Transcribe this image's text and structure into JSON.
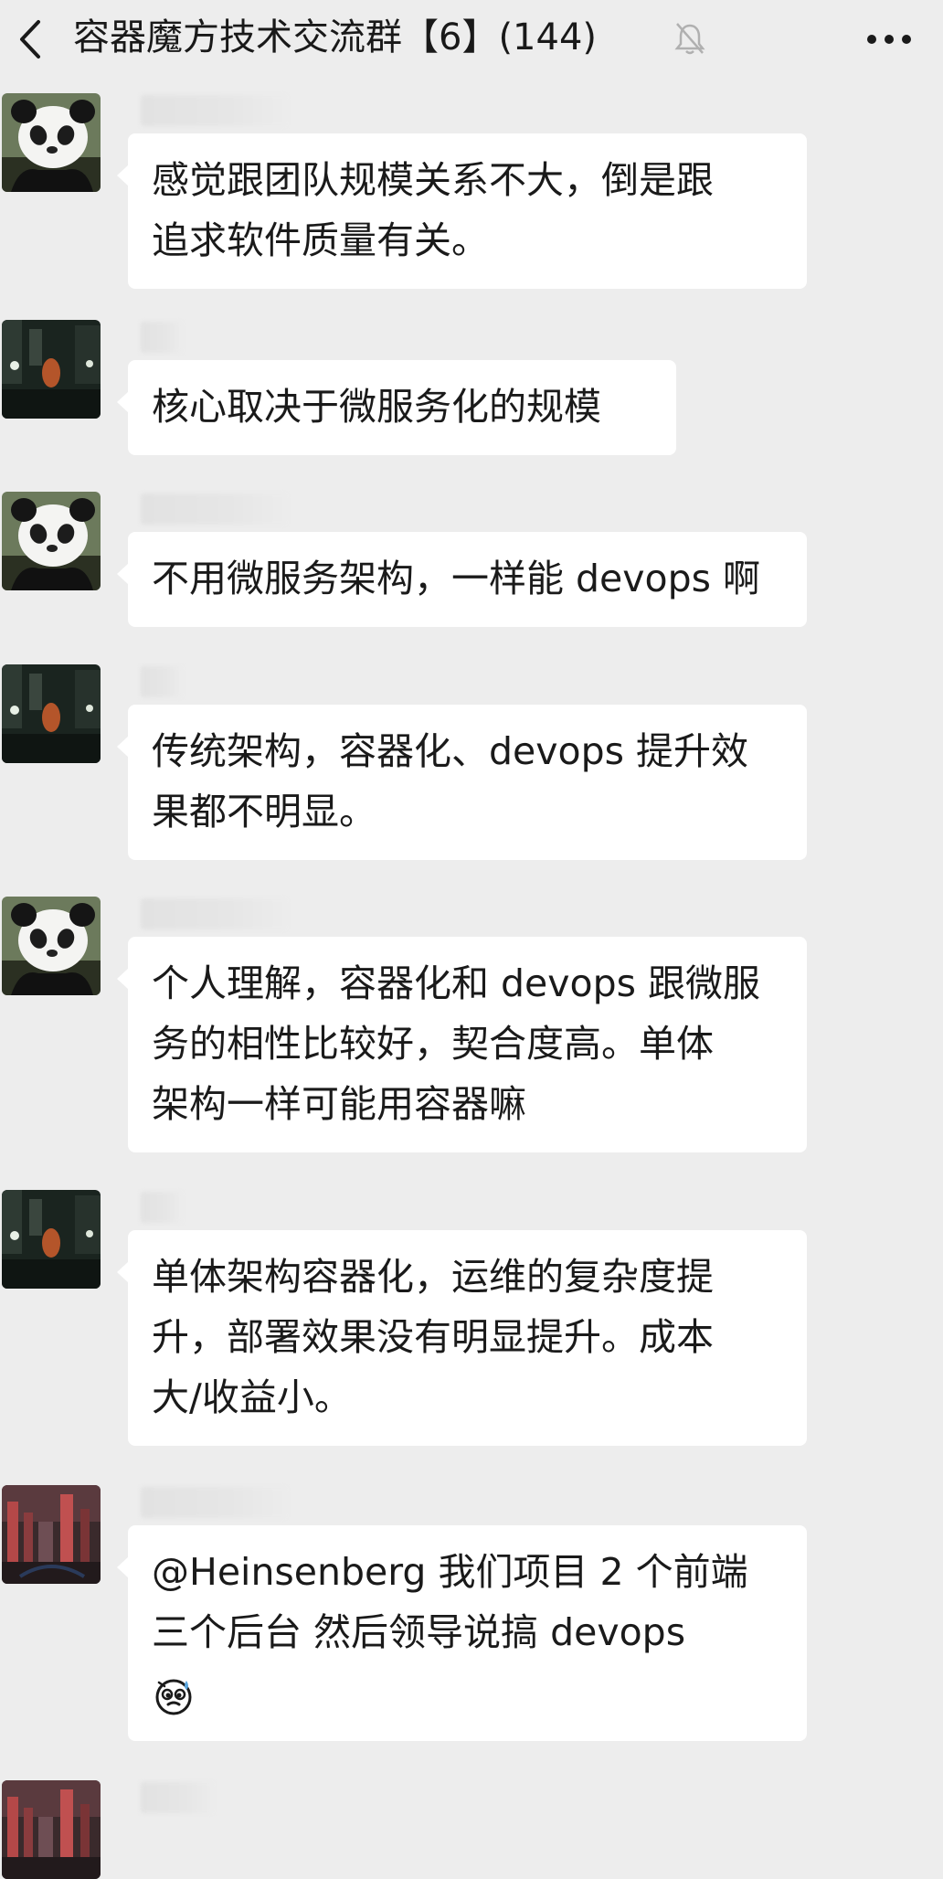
{
  "header": {
    "title": "容器魔方技术交流群【6】(144)",
    "back_icon": "chevron-left-icon",
    "mute_icon": "bell-muted-icon",
    "more_icon": "more-horizontal-icon"
  },
  "messages": [
    {
      "avatar": "panda-avatar",
      "lines": [
        "感觉跟团队规模关系不大，倒是跟",
        "追求软件质量有关。"
      ]
    },
    {
      "avatar": "night-city-avatar",
      "lines": [
        "核心取决于微服务化的规模"
      ]
    },
    {
      "avatar": "panda-avatar",
      "lines": [
        "不用微服务架构，一样能 devops 啊"
      ]
    },
    {
      "avatar": "night-city-avatar",
      "lines": [
        "传统架构，容器化、devops 提升效",
        "果都不明显。"
      ]
    },
    {
      "avatar": "panda-avatar",
      "lines": [
        "个人理解，容器化和 devops 跟微服",
        "务的相性比较好，契合度高。单体",
        "架构一样可能用容器嘛"
      ]
    },
    {
      "avatar": "night-city-avatar",
      "lines": [
        "单体架构容器化，运维的复杂度提",
        "升，部署效果没有明显提升。成本",
        "大/收益小。"
      ]
    },
    {
      "avatar": "red-city-avatar",
      "lines": [
        "@Heinsenberg  我们项目 2 个前端",
        "三个后台   然后领导说搞 devops"
      ],
      "emoji": "sweat-face-emoji-icon"
    }
  ],
  "colors": {
    "background": "#ededed",
    "bubble": "#ffffff",
    "text": "#1a1a1a"
  }
}
